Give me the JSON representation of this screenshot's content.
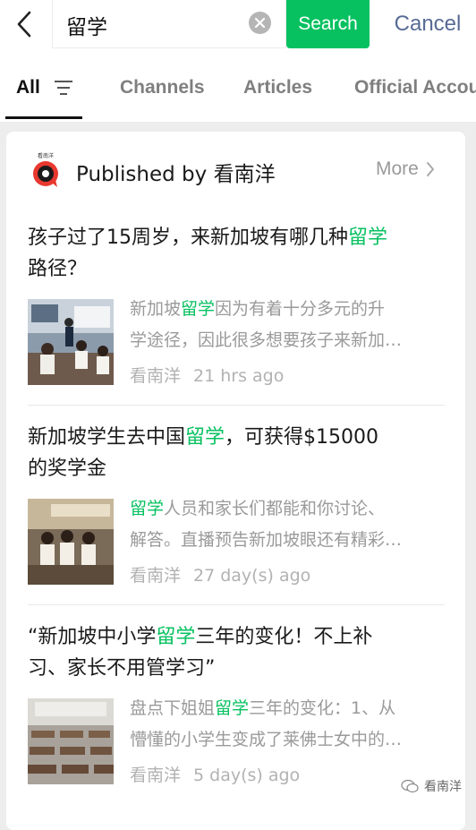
{
  "search": {
    "query": "留学",
    "search_label": "Search",
    "cancel_label": "Cancel"
  },
  "tabs": [
    {
      "label": "All",
      "active": true
    },
    {
      "label": "Channels",
      "active": false
    },
    {
      "label": "Articles",
      "active": false
    },
    {
      "label": "Official Accou",
      "active": false
    }
  ],
  "publisher": {
    "title": "Published by 看南洋",
    "more_label": "More",
    "logo_text": "看南洋"
  },
  "articles": [
    {
      "title_parts": [
        "孩子过了15周岁，来新加坡有哪几种",
        "留学",
        "路径？"
      ],
      "desc_parts": [
        "新加坡",
        "留学",
        "因为有着十分多元的升"
      ],
      "desc_line2": "学途径，因此很多想要孩子来新加…",
      "source": "看南洋",
      "time": "21 hrs ago"
    },
    {
      "title_parts": [
        "新加坡学生去中国",
        "留学",
        "，可获得$15000"
      ],
      "title_line2": "的奖学金",
      "desc_parts": [
        "",
        "留学",
        "人员和家长们都能和你讨论、"
      ],
      "desc_line2": "解答。直播预告新加坡眼还有精彩…",
      "source": "看南洋",
      "time": "27 day(s) ago"
    },
    {
      "title_parts": [
        "“新加坡中小学",
        "留学",
        "三年的变化！不上补"
      ],
      "title_line2": "习、家长不用管学习”",
      "desc_parts": [
        "盘点下姐姐",
        "留学",
        "三年的变化：1、从"
      ],
      "desc_line2": "懵懂的小学生变成了莱佛士女中的…",
      "source": "看南洋",
      "time": "5 day(s) ago"
    }
  ],
  "watermark": {
    "text": "看南洋"
  },
  "colors": {
    "accent": "#07c160",
    "link": "#576b95",
    "muted": "#9a9a9a"
  }
}
